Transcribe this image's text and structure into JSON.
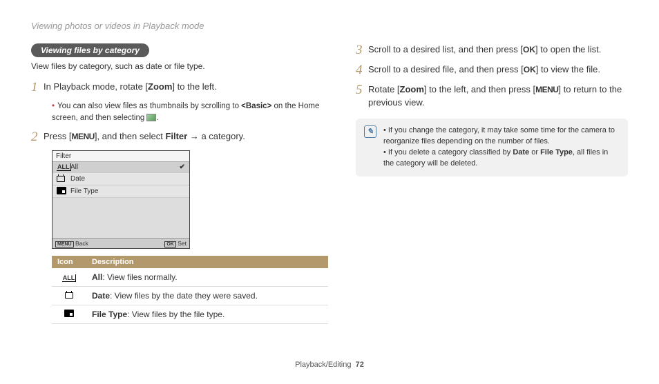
{
  "breadcrumb": "Viewing photos or videos in Playback mode",
  "section_pill": "Viewing files by category",
  "intro": "View files by category, such as date or file type.",
  "steps_left": [
    {
      "num": "1",
      "parts": [
        "In Playback mode, rotate [",
        "Zoom",
        "] to the left."
      ],
      "sub_parts": [
        "You can also view files as thumbnails by scrolling to ",
        "<Basic>",
        " on the Home screen, and then selecting ",
        "THUMB_ICON",
        "."
      ]
    },
    {
      "num": "2",
      "parts": [
        "Press [",
        "MENU_GLYPH",
        "], and then select ",
        "Filter",
        " → a category."
      ]
    }
  ],
  "screenshot": {
    "title": "Filter",
    "rows": [
      {
        "icon": "ALL",
        "label": "All",
        "selected": true
      },
      {
        "icon": "CAL",
        "label": "Date",
        "selected": false
      },
      {
        "icon": "FT",
        "label": "File Type",
        "selected": false
      }
    ],
    "footer_left_key": "MENU",
    "footer_left_label": "Back",
    "footer_right_key": "OK",
    "footer_right_label": "Set"
  },
  "desc_table": {
    "headers": [
      "Icon",
      "Description"
    ],
    "rows": [
      {
        "icon": "ALL",
        "bold": "All",
        "rest": ": View files normally."
      },
      {
        "icon": "CAL",
        "bold": "Date",
        "rest": ": View files by the date they were saved."
      },
      {
        "icon": "FT",
        "bold": "File Type",
        "rest": ": View files by the file type."
      }
    ]
  },
  "steps_right": [
    {
      "num": "3",
      "parts": [
        "Scroll to a desired list, and then press [",
        "OK_GLYPH",
        "] to open the list."
      ]
    },
    {
      "num": "4",
      "parts": [
        "Scroll to a desired file, and then press [",
        "OK_GLYPH",
        "] to view the file."
      ]
    },
    {
      "num": "5",
      "parts": [
        "Rotate [",
        "Zoom",
        "] to the left, and then press [",
        "MENU_GLYPH",
        "] to return to the previous view."
      ]
    }
  ],
  "notes": [
    {
      "plain": "If you change the category, it may take some time for the camera to reorganize files depending on the number of files."
    },
    {
      "parts": [
        "If you delete a category classified by ",
        "Date",
        " or ",
        "File Type",
        ", all files in the category will be deleted."
      ]
    }
  ],
  "footer_section": "Playback/Editing",
  "footer_page": "72"
}
